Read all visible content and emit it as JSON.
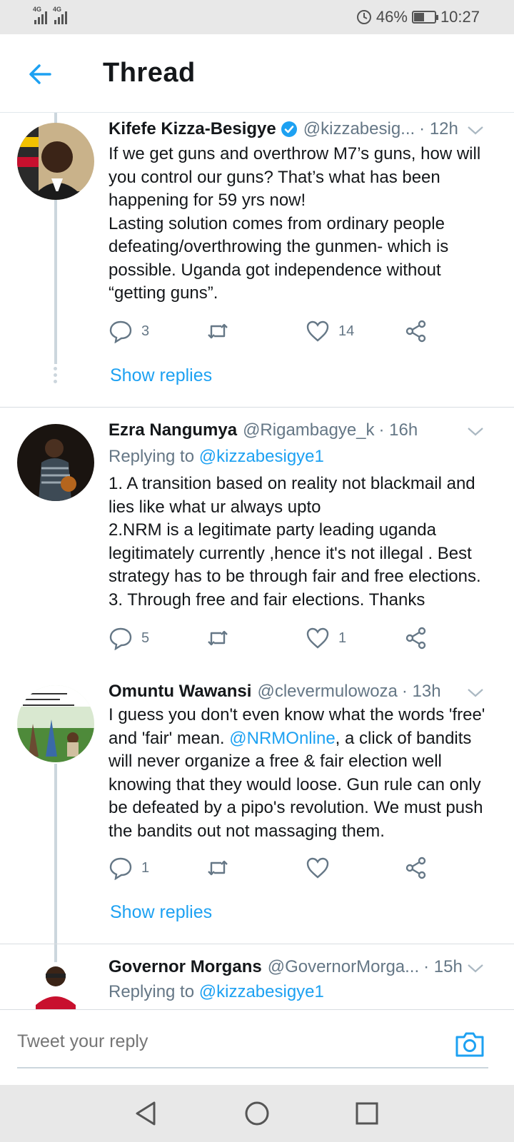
{
  "status_bar": {
    "signal1_label": "4G",
    "signal2_label": "4G",
    "battery_percent": "46%",
    "battery_level": 0.46,
    "time": "10:27"
  },
  "header": {
    "title": "Thread"
  },
  "tweets": [
    {
      "name": "Kifefe Kizza-Besigye",
      "verified": true,
      "handle": "@kizzabesig...",
      "time": "· 12h",
      "body_lines": [
        "If we get guns and overthrow M7’s guns, how will",
        "you control our guns? That’s what has been",
        "happening for 59 yrs now!",
        "Lasting solution comes from ordinary people",
        "defeating/overthrowing the gunmen- which is",
        "possible. Uganda got independence without",
        "“getting guns”."
      ],
      "replies": "3",
      "likes": "14",
      "show_replies": "Show replies"
    },
    {
      "name": "Ezra Nangumya",
      "handle": "@Rigambagye_k",
      "time": "· 16h",
      "replying_prefix": "Replying to",
      "replying_to": "@kizzabesigye1",
      "body_lines": [
        "1. A transition based on reality not blackmail and",
        "lies like what ur always upto",
        "2.NRM is a legitimate party leading uganda",
        "legitimately currently ,hence it's not illegal . Best",
        "strategy has to be through fair and free elections.",
        "3. Through free and fair elections. Thanks"
      ],
      "replies": "5",
      "likes": "1"
    },
    {
      "name": "Omuntu Wawansi",
      "handle": "@clevermulowoza",
      "time": "· 13h",
      "body_line1": "I guess you don't even know what the words 'free'",
      "body_line2_pre": "and 'fair' mean. ",
      "body_mention": "@NRMOnline",
      "body_line2_post": ", a click of bandits",
      "body_lines_rest": [
        "will never organize a free & fair election well",
        "knowing that they would loose. Gun rule can only",
        "be defeated by a pipo's revolution. We must push",
        "the bandits out not massaging them."
      ],
      "replies": "1",
      "likes": "",
      "show_replies": "Show replies"
    },
    {
      "name": "Governor Morgans",
      "handle": "@GovernorMorga...",
      "time": "· 15h",
      "replying_prefix": "Replying to",
      "replying_to": "@kizzabesigye1"
    }
  ],
  "reply_bar": {
    "placeholder": "Tweet your reply"
  },
  "icons": {
    "back": "arrow-left-icon",
    "chevron": "chevron-down-icon",
    "reply": "comment-icon",
    "retweet": "retweet-icon",
    "like": "heart-icon",
    "share": "share-icon",
    "camera": "camera-icon"
  },
  "colors": {
    "accent": "#1da1f2",
    "text": "#14171a",
    "secondary": "#657786"
  }
}
